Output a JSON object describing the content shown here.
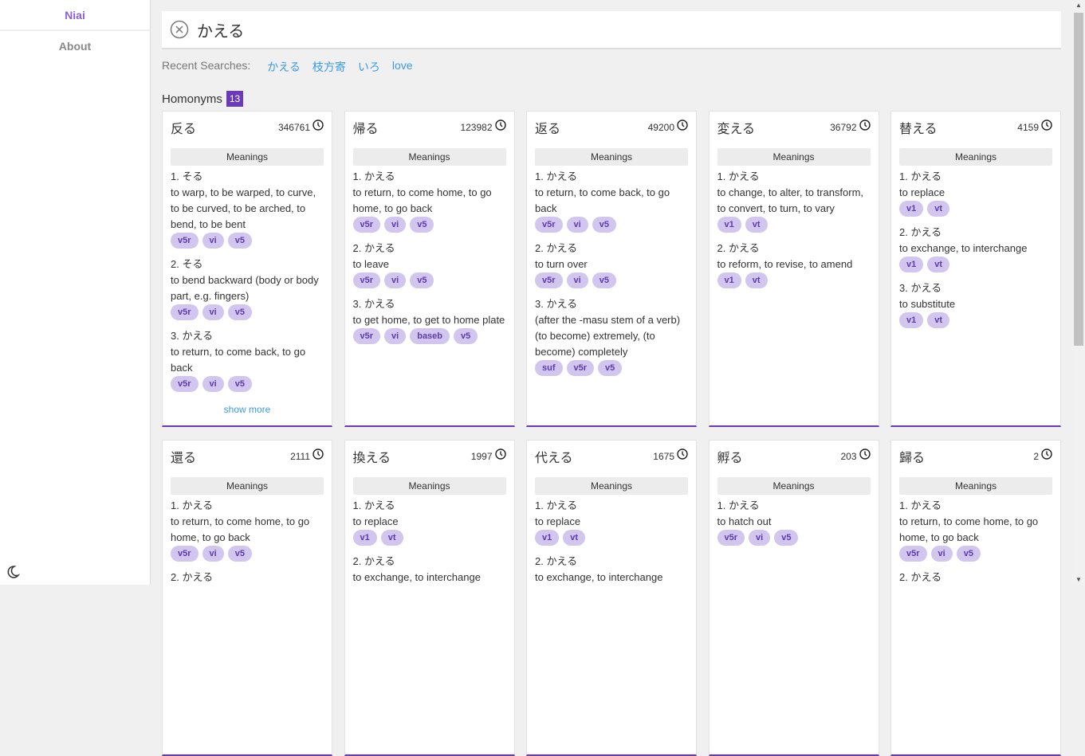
{
  "sidebar": {
    "brand": "Niai",
    "about": "About"
  },
  "search": {
    "value": "かえる"
  },
  "recent": {
    "label": "Recent Searches:",
    "items": [
      "かえる",
      "枝方寄",
      "いろ",
      "love"
    ]
  },
  "homonyms": {
    "label": "Homonyms",
    "count": "13"
  },
  "meanings_label": "Meanings",
  "show_more": "show more",
  "cards": [
    {
      "word": "反る",
      "freq": "346761",
      "senses": [
        {
          "h": "1. そる",
          "t": "to warp, to be warped, to curve, to be curved, to be arched, to bend, to be bent",
          "tags": [
            "v5r",
            "vi",
            "v5"
          ]
        },
        {
          "h": "2. そる",
          "t": "to bend backward (body or body part, e.g. fingers)",
          "tags": [
            "v5r",
            "vi",
            "v5"
          ]
        },
        {
          "h": "3. かえる",
          "t": "to return, to come back, to go back",
          "tags": [
            "v5r",
            "vi",
            "v5"
          ]
        }
      ],
      "more": true
    },
    {
      "word": "帰る",
      "freq": "123982",
      "senses": [
        {
          "h": "1. かえる",
          "t": "to return, to come home, to go home, to go back",
          "tags": [
            "v5r",
            "vi",
            "v5"
          ]
        },
        {
          "h": "2. かえる",
          "t": "to leave",
          "tags": [
            "v5r",
            "vi",
            "v5"
          ]
        },
        {
          "h": "3. かえる",
          "t": "to get home, to get to home plate",
          "tags": [
            "v5r",
            "vi",
            "baseb",
            "v5"
          ]
        }
      ]
    },
    {
      "word": "返る",
      "freq": "49200",
      "senses": [
        {
          "h": "1. かえる",
          "t": "to return, to come back, to go back",
          "tags": [
            "v5r",
            "vi",
            "v5"
          ]
        },
        {
          "h": "2. かえる",
          "t": "to turn over",
          "tags": [
            "v5r",
            "vi",
            "v5"
          ]
        },
        {
          "h": "3. かえる",
          "t": "(after the -masu stem of a verb) (to become) extremely, (to become) completely",
          "tags": [
            "suf",
            "v5r",
            "v5"
          ]
        }
      ]
    },
    {
      "word": "変える",
      "freq": "36792",
      "senses": [
        {
          "h": "1. かえる",
          "t": "to change, to alter, to transform, to convert, to turn, to vary",
          "tags": [
            "v1",
            "vt"
          ]
        },
        {
          "h": "2. かえる",
          "t": "to reform, to revise, to amend",
          "tags": [
            "v1",
            "vt"
          ]
        }
      ]
    },
    {
      "word": "替える",
      "freq": "4159",
      "senses": [
        {
          "h": "1. かえる",
          "t": "to replace",
          "tags": [
            "v1",
            "vt"
          ]
        },
        {
          "h": "2. かえる",
          "t": "to exchange, to interchange",
          "tags": [
            "v1",
            "vt"
          ]
        },
        {
          "h": "3. かえる",
          "t": "to substitute",
          "tags": [
            "v1",
            "vt"
          ]
        }
      ]
    },
    {
      "word": "還る",
      "freq": "2111",
      "senses": [
        {
          "h": "1. かえる",
          "t": "to return, to come home, to go home, to go back",
          "tags": [
            "v5r",
            "vi",
            "v5"
          ]
        },
        {
          "h": "2. かえる",
          "t": "",
          "tags": []
        }
      ]
    },
    {
      "word": "換える",
      "freq": "1997",
      "senses": [
        {
          "h": "1. かえる",
          "t": "to replace",
          "tags": [
            "v1",
            "vt"
          ]
        },
        {
          "h": "2. かえる",
          "t": "to exchange, to interchange",
          "tags": []
        }
      ]
    },
    {
      "word": "代える",
      "freq": "1675",
      "senses": [
        {
          "h": "1. かえる",
          "t": "to replace",
          "tags": [
            "v1",
            "vt"
          ]
        },
        {
          "h": "2. かえる",
          "t": "to exchange, to interchange",
          "tags": []
        }
      ]
    },
    {
      "word": "孵る",
      "freq": "203",
      "senses": [
        {
          "h": "1. かえる",
          "t": "to hatch out",
          "tags": [
            "v5r",
            "vi",
            "v5"
          ]
        }
      ]
    },
    {
      "word": "歸る",
      "freq": "2",
      "senses": [
        {
          "h": "1. かえる",
          "t": "to return, to come home, to go home, to go back",
          "tags": [
            "v5r",
            "vi",
            "v5"
          ]
        },
        {
          "h": "2. かえる",
          "t": "",
          "tags": []
        }
      ]
    }
  ]
}
